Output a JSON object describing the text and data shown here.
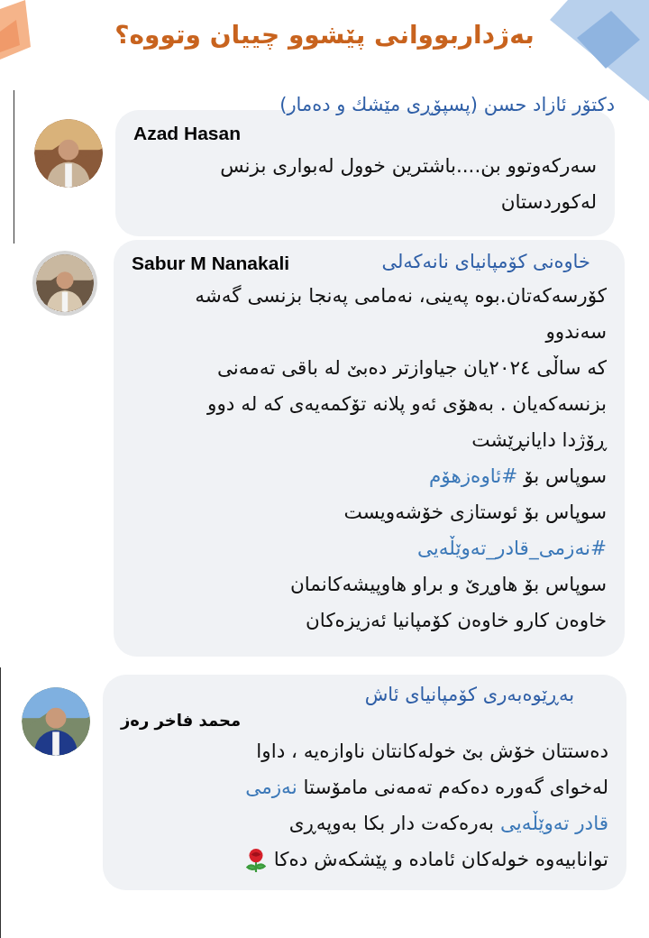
{
  "title": "بەژداربووانی پێشوو چییان وتووە؟",
  "comments": [
    {
      "caption": "دکتۆر ئازاد حسن (پسپۆڕی مێشك و دەمار)",
      "author": "Azad Hasan",
      "avatar": {
        "kind": "picture"
      },
      "lines": [
        [
          {
            "kind": "text",
            "text": "سەرکەوتوو بن....باشترین خوول لەبواری بزنس"
          }
        ],
        [
          {
            "kind": "text",
            "text": "لەکوردستان"
          }
        ]
      ]
    },
    {
      "caption": "خاوەنی کۆمپانیای نانەکەلی",
      "author": "Sabur M Nanakali",
      "avatar": {
        "kind": "picture"
      },
      "lines": [
        [
          {
            "kind": "text",
            "text": "کۆرسەکەتان.بوە پەینی، نەمامی پەنجا بزنسی گەشە"
          }
        ],
        [
          {
            "kind": "text",
            "text": "سەندوو"
          }
        ],
        [
          {
            "kind": "text",
            "text": "کە ساڵی ٢٠٢٤یان جیاوازتر دەبێ لە باقی تەمەنی"
          }
        ],
        [
          {
            "kind": "text",
            "text": "بزنسەکەیان . بەهۆی ئەو پلانە تۆکمەیەی کە لە دوو"
          }
        ],
        [
          {
            "kind": "text",
            "text": "ڕۆژدا دایانڕێشت"
          }
        ],
        [
          {
            "kind": "text",
            "text": "سوپاس بۆ "
          },
          {
            "kind": "tag",
            "text": "#ئاوەزهۆم"
          }
        ],
        [
          {
            "kind": "text",
            "text": "سوپاس بۆ ئوستازی خۆشەویست"
          }
        ],
        [
          {
            "kind": "tag",
            "text": "#نەزمی_قادر_تەوێڵەیی"
          }
        ],
        [
          {
            "kind": "text",
            "text": "سوپاس  بۆ هاوڕێ و براو هاوپیشەکانمان"
          }
        ],
        [
          {
            "kind": "text",
            "text": "خاوەن کارو خاوەن کۆمپانیا  ئەزیزەکان"
          }
        ]
      ]
    },
    {
      "caption": "بەڕێوەبەری کۆمپانیای ئاش",
      "author": "محمد فاخر رەز",
      "avatar": {
        "kind": "picture"
      },
      "lines": [
        [
          {
            "kind": "text",
            "text": "دەستتان خۆش بێ خولەکانتان ناوازەیە ، داوا"
          }
        ],
        [
          {
            "kind": "text",
            "text": "لەخوای گەورە دەکەم تەمەنی مامۆستا "
          },
          {
            "kind": "tag",
            "text": "نەزمی"
          }
        ],
        [
          {
            "kind": "tag",
            "text": "قادر تەوێڵەیی"
          },
          {
            "kind": "text",
            "text": " بەرەکەت دار بکا بەوپەڕی"
          }
        ],
        [
          {
            "kind": "text",
            "text": "توانابیەوە خولەکان ئامادە و پێشکەش دەکا "
          },
          {
            "kind": "icon"
          }
        ]
      ]
    }
  ]
}
